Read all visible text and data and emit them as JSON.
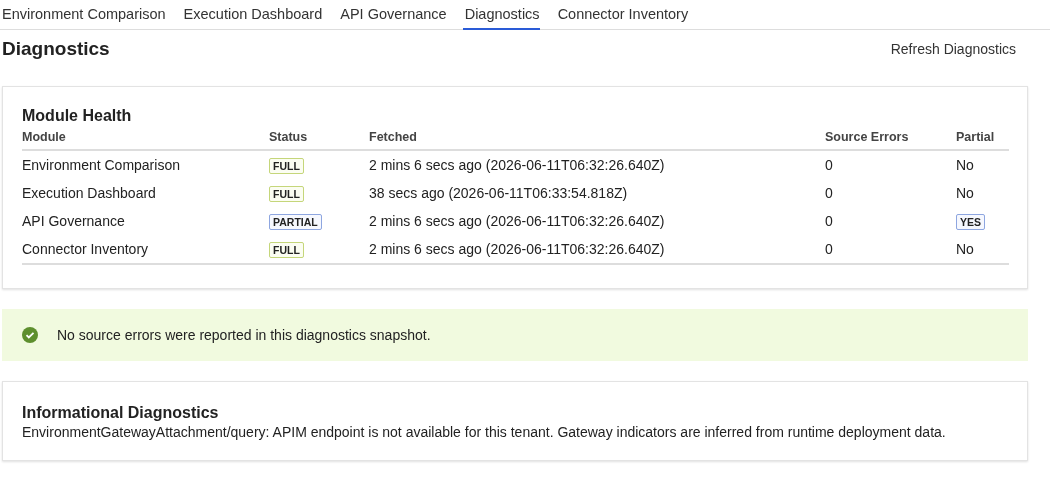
{
  "tabs": [
    {
      "label": "Environment Comparison",
      "selected": false
    },
    {
      "label": "Execution Dashboard",
      "selected": false
    },
    {
      "label": "API Governance",
      "selected": false
    },
    {
      "label": "Diagnostics",
      "selected": true
    },
    {
      "label": "Connector Inventory",
      "selected": false
    }
  ],
  "page": {
    "title": "Diagnostics",
    "action": "Refresh Diagnostics"
  },
  "module_health": {
    "title": "Module Health",
    "columns": [
      "Module",
      "Status",
      "Fetched",
      "Source Errors",
      "Partial"
    ],
    "rows": [
      {
        "module": "Environment Comparison",
        "status": {
          "text": "FULL",
          "kind": "full"
        },
        "fetched": "2 mins 6 secs ago (2026-06-11T06:32:26.640Z)",
        "source_errors": "0",
        "partial": {
          "text": "No",
          "flagged": false
        }
      },
      {
        "module": "Execution Dashboard",
        "status": {
          "text": "FULL",
          "kind": "full"
        },
        "fetched": "38 secs ago (2026-06-11T06:33:54.818Z)",
        "source_errors": "0",
        "partial": {
          "text": "No",
          "flagged": false
        }
      },
      {
        "module": "API Governance",
        "status": {
          "text": "PARTIAL",
          "kind": "partial"
        },
        "fetched": "2 mins 6 secs ago (2026-06-11T06:32:26.640Z)",
        "source_errors": "0",
        "partial": {
          "text": "YES",
          "flagged": true
        }
      },
      {
        "module": "Connector Inventory",
        "status": {
          "text": "FULL",
          "kind": "full"
        },
        "fetched": "2 mins 6 secs ago (2026-06-11T06:32:26.640Z)",
        "source_errors": "0",
        "partial": {
          "text": "No",
          "flagged": false
        }
      }
    ]
  },
  "success_banner": {
    "message": "No source errors were reported in this diagnostics snapshot."
  },
  "informational": {
    "title": "Informational Diagnostics",
    "message": "EnvironmentGatewayAttachment/query: APIM endpoint is not available for this tenant. Gateway indicators are inferred from runtime deployment data."
  }
}
